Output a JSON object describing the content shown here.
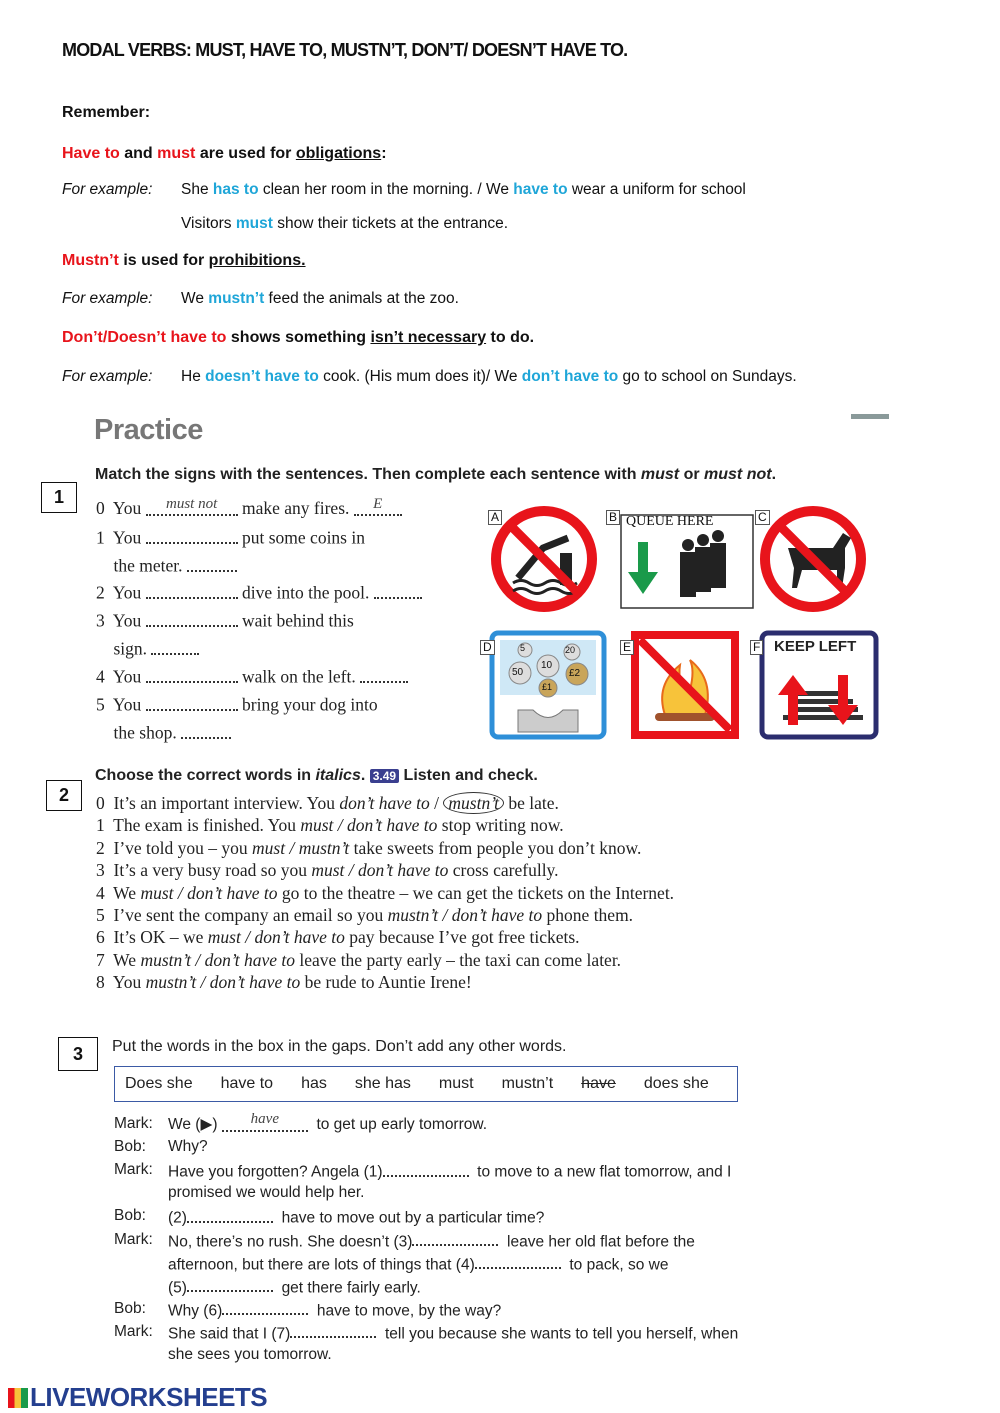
{
  "title": "MODAL VERBS: MUST, HAVE TO, MUSTN’T, DON’T/ DOESN’T HAVE TO.",
  "remember": "Remember:",
  "rule1": {
    "a": "Have to",
    "b": " and ",
    "c": "must",
    "d": " are used for ",
    "e": "obligations",
    "f": ":"
  },
  "example_label": "For example:",
  "ex1a": {
    "a": "She ",
    "b": "has to",
    "c": " clean her room in the morning. / We ",
    "d": "have to",
    "e": " wear a uniform for school"
  },
  "ex1b": {
    "a": "Visitors ",
    "b": "must",
    "c": " show their tickets at the entrance."
  },
  "rule2": {
    "a": "Mustn’t",
    "b": " is used for ",
    "c": "prohibitions."
  },
  "ex2": {
    "a": "We ",
    "b": "mustn’t",
    "c": " feed the animals at the zoo."
  },
  "rule3": {
    "a": "Don’t/Doesn’t have to",
    "b": " shows something ",
    "c": "isn’t necessary",
    "d": " to do."
  },
  "ex3": {
    "a": "He ",
    "b": "doesn’t have to",
    "c": " cook. (His mum does it)/ We ",
    "d": "don’t have to",
    "e": " go to school on Sundays."
  },
  "practice": "Practice",
  "exercise1": {
    "number": "1",
    "instruction": {
      "a": "Match the signs with the sentences. Then complete each sentence with ",
      "b": "must",
      "c": " or ",
      "d": "must not",
      "e": "."
    },
    "lines": [
      [
        {
          "k": "t",
          "v": "0  You "
        },
        {
          "k": "blank",
          "v": "must not",
          "w": 92
        },
        {
          "k": "t",
          "v": " make any fires. "
        },
        {
          "k": "blank",
          "v": "E",
          "w": 48
        }
      ],
      [
        {
          "k": "t",
          "v": "1  You "
        },
        {
          "k": "blank",
          "v": "",
          "w": 92
        },
        {
          "k": "t",
          "v": " put some coins in"
        }
      ],
      [
        {
          "k": "t",
          "v": "    the meter. "
        },
        {
          "k": "blank",
          "v": "",
          "w": 50
        }
      ],
      [
        {
          "k": "t",
          "v": "2  You "
        },
        {
          "k": "blank",
          "v": "",
          "w": 92
        },
        {
          "k": "t",
          "v": " dive into the pool. "
        },
        {
          "k": "blank",
          "v": "",
          "w": 48
        }
      ],
      [
        {
          "k": "t",
          "v": "3  You "
        },
        {
          "k": "blank",
          "v": "",
          "w": 92
        },
        {
          "k": "t",
          "v": " wait behind this"
        }
      ],
      [
        {
          "k": "t",
          "v": "    sign. "
        },
        {
          "k": "blank",
          "v": "",
          "w": 48
        }
      ],
      [
        {
          "k": "t",
          "v": "4  You "
        },
        {
          "k": "blank",
          "v": "",
          "w": 92
        },
        {
          "k": "t",
          "v": " walk on the left. "
        },
        {
          "k": "blank",
          "v": "",
          "w": 48
        }
      ],
      [
        {
          "k": "t",
          "v": "5  You "
        },
        {
          "k": "blank",
          "v": "",
          "w": 92
        },
        {
          "k": "t",
          "v": " bring your dog into"
        }
      ],
      [
        {
          "k": "t",
          "v": "    the shop. "
        },
        {
          "k": "blank",
          "v": "",
          "w": 50
        }
      ]
    ],
    "signs": {
      "A": {
        "label": "A",
        "icon": "no-diving-sign"
      },
      "B": {
        "label": "B",
        "icon": "queue-here-sign",
        "text": "QUEUE HERE"
      },
      "C": {
        "label": "C",
        "icon": "no-dogs-sign"
      },
      "D": {
        "label": "D",
        "icon": "coin-meter-sign",
        "coins": [
          "5",
          "20",
          "50",
          "10",
          "£2",
          "£1"
        ]
      },
      "E": {
        "label": "E",
        "icon": "no-fires-sign"
      },
      "F": {
        "label": "F",
        "icon": "keep-left-sign",
        "text": "KEEP LEFT"
      }
    }
  },
  "exercise2": {
    "number": "2",
    "instruction": {
      "a": "Choose the correct words in ",
      "b": "italics",
      "c": ". ",
      "audio": "3.49",
      "d": " Listen and check."
    },
    "lines": [
      [
        {
          "k": "t",
          "v": "0  It’s an important interview. You "
        },
        {
          "k": "i",
          "v": "don’t have to"
        },
        {
          "k": "t",
          "v": " / "
        },
        {
          "k": "c",
          "v": "mustn’t"
        },
        {
          "k": "t",
          "v": " be late."
        }
      ],
      [
        {
          "k": "t",
          "v": "1  The exam is finished. You "
        },
        {
          "k": "i",
          "v": "must / don’t have to"
        },
        {
          "k": "t",
          "v": " stop writing now."
        }
      ],
      [
        {
          "k": "t",
          "v": "2  I’ve told you – you "
        },
        {
          "k": "i",
          "v": "must / mustn’t"
        },
        {
          "k": "t",
          "v": " take sweets from people you don’t know."
        }
      ],
      [
        {
          "k": "t",
          "v": "3  It’s a very busy road so you "
        },
        {
          "k": "i",
          "v": "must / don’t have to"
        },
        {
          "k": "t",
          "v": " cross carefully."
        }
      ],
      [
        {
          "k": "t",
          "v": "4  We "
        },
        {
          "k": "i",
          "v": "must / don’t have to"
        },
        {
          "k": "t",
          "v": " go to the theatre – we can get the tickets on the Internet."
        }
      ],
      [
        {
          "k": "t",
          "v": "5  I’ve sent the company an email so you "
        },
        {
          "k": "i",
          "v": "mustn’t / don’t have to"
        },
        {
          "k": "t",
          "v": " phone them."
        }
      ],
      [
        {
          "k": "t",
          "v": "6  It’s OK – we "
        },
        {
          "k": "i",
          "v": "must / don’t have to"
        },
        {
          "k": "t",
          "v": " pay because I’ve got free tickets."
        }
      ],
      [
        {
          "k": "t",
          "v": "7  We "
        },
        {
          "k": "i",
          "v": "mustn’t / don’t have to"
        },
        {
          "k": "t",
          "v": " leave the party early – the taxi can come later."
        }
      ],
      [
        {
          "k": "t",
          "v": "8  You "
        },
        {
          "k": "i",
          "v": "mustn’t / don’t have to"
        },
        {
          "k": "t",
          "v": " be rude to Auntie Irene!"
        }
      ]
    ]
  },
  "exercise3": {
    "number": "3",
    "instruction": "Put the words in the box in the gaps. Don’t add any other words.",
    "words": [
      {
        "v": "Does she"
      },
      {
        "v": "have to"
      },
      {
        "v": "has"
      },
      {
        "v": "she has"
      },
      {
        "v": "must"
      },
      {
        "v": "mustn’t"
      },
      {
        "v": "have",
        "struck": true
      },
      {
        "v": "does she"
      }
    ],
    "lines": [
      {
        "speaker": "Mark:",
        "parts": [
          {
            "k": "t",
            "v": "We (▶) "
          },
          {
            "k": "blank",
            "v": "have",
            "w": 86
          },
          {
            "k": "t",
            "v": "  to get up early tomorrow."
          }
        ]
      },
      {
        "speaker": "Bob:",
        "parts": [
          {
            "k": "t",
            "v": "Why?"
          }
        ]
      },
      {
        "speaker": "Mark:",
        "parts": [
          {
            "k": "t",
            "v": "Have you forgotten? Angela (1)"
          },
          {
            "k": "blank",
            "v": "",
            "w": 86
          },
          {
            "k": "t",
            "v": "  to move to a new flat tomorrow, and I"
          }
        ]
      },
      {
        "speaker": "",
        "parts": [
          {
            "k": "t",
            "v": "promised we would help her."
          }
        ]
      },
      {
        "speaker": "Bob:",
        "parts": [
          {
            "k": "t",
            "v": "(2)"
          },
          {
            "k": "blank",
            "v": "",
            "w": 86
          },
          {
            "k": "t",
            "v": "  have to move out by a particular time?"
          }
        ]
      },
      {
        "speaker": "Mark:",
        "parts": [
          {
            "k": "t",
            "v": "No, there’s no rush. She doesn’t (3)"
          },
          {
            "k": "blank",
            "v": "",
            "w": 86
          },
          {
            "k": "t",
            "v": "  leave her old flat before the"
          }
        ]
      },
      {
        "speaker": "",
        "parts": [
          {
            "k": "t",
            "v": "afternoon, but there are lots of things that (4)"
          },
          {
            "k": "blank",
            "v": "",
            "w": 86
          },
          {
            "k": "t",
            "v": "  to pack, so we"
          }
        ]
      },
      {
        "speaker": "",
        "parts": [
          {
            "k": "t",
            "v": "(5)"
          },
          {
            "k": "blank",
            "v": "",
            "w": 86
          },
          {
            "k": "t",
            "v": "  get there fairly early."
          }
        ]
      },
      {
        "speaker": "Bob:",
        "parts": [
          {
            "k": "t",
            "v": "Why (6)"
          },
          {
            "k": "blank",
            "v": "",
            "w": 86
          },
          {
            "k": "t",
            "v": "  have to move, by the way?"
          }
        ]
      },
      {
        "speaker": "Mark:",
        "parts": [
          {
            "k": "t",
            "v": "She said that I (7)"
          },
          {
            "k": "blank",
            "v": "",
            "w": 86
          },
          {
            "k": "t",
            "v": "  tell you because she wants to tell you herself, when"
          }
        ]
      },
      {
        "speaker": "",
        "parts": [
          {
            "k": "t",
            "v": "she sees you tomorrow."
          }
        ]
      }
    ]
  },
  "logo": "LIVEWORKSHEETS",
  "colors": {
    "rule_red": "#e8141b",
    "example_blue": "#1fa6d8",
    "sign_red": "#e8141b",
    "logo_blue": "#243f8f"
  }
}
